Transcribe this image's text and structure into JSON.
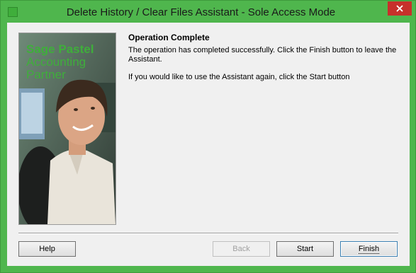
{
  "window": {
    "title": "Delete History / Clear Files Assistant - Sole Access Mode"
  },
  "side_panel": {
    "brand_line1": "Sage Pastel",
    "brand_line2": "Accounting",
    "brand_line3": "Partner"
  },
  "content": {
    "heading": "Operation Complete",
    "message1": "The operation has completed successfully. Click the Finish button to leave the Assistant.",
    "message2": "If you would like to use the Assistant again, click the Start button"
  },
  "buttons": {
    "help": "Help",
    "back": "Back",
    "start": "Start",
    "finish": "Finish"
  },
  "colors": {
    "title_bar": "#4fb64d",
    "close_button": "#c7302b",
    "brand": "#3fae3b"
  }
}
